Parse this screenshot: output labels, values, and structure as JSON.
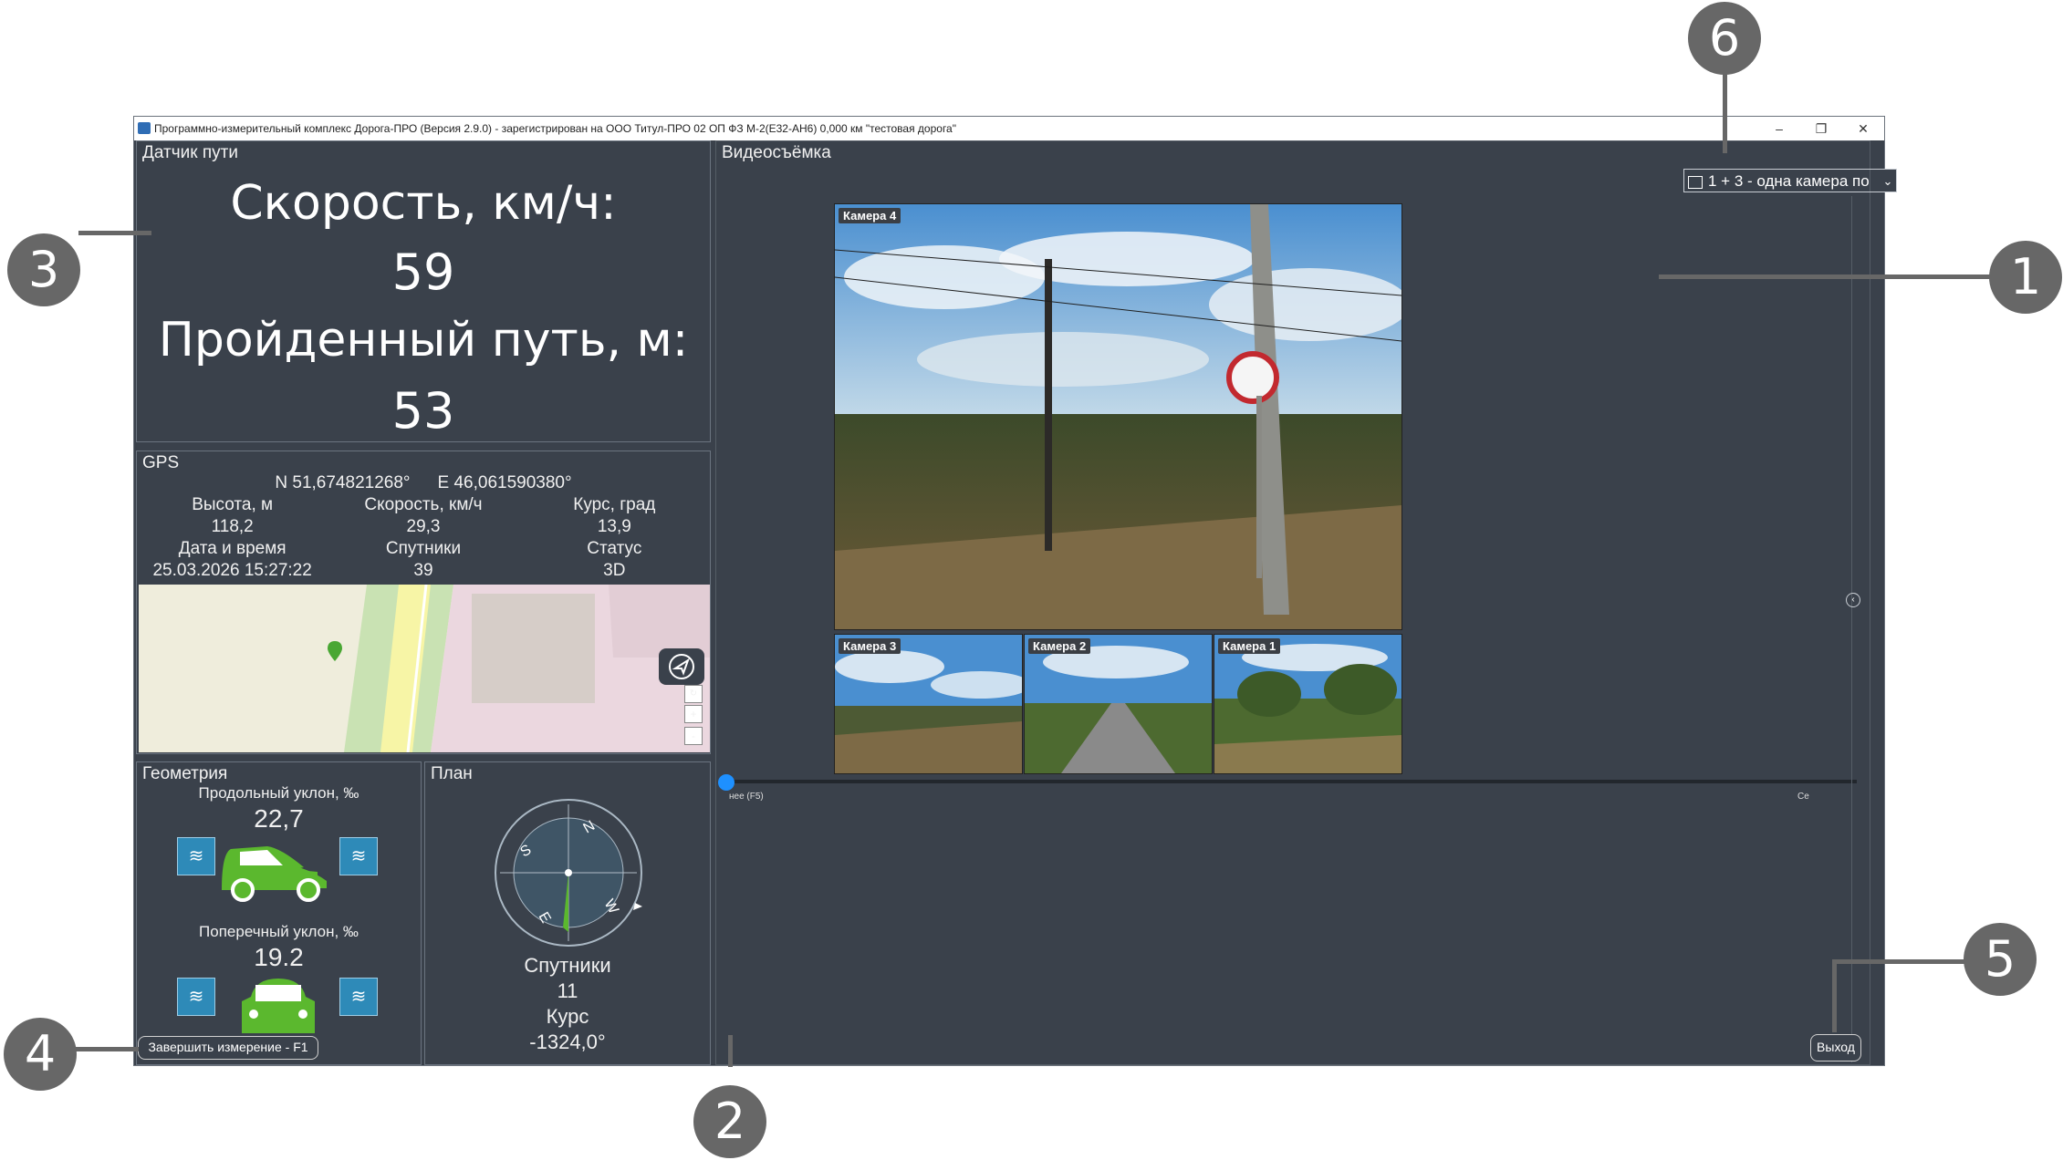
{
  "window": {
    "title": "Программно-измерительный комплекс Дорога-ПРО (Версия 2.9.0) - зарегистрирован на ООО Титул-ПРО 02 ОП ФЗ М-2(Е32-АН6) 0,000 км \"тестовая дорога\"",
    "minimize": "–",
    "maximize": "❐",
    "close": "✕"
  },
  "odometer": {
    "title": "Датчик пути",
    "speed_label": "Скорость, км/ч:",
    "speed_value": "59",
    "distance_label": "Пройденный путь, м:",
    "distance_value": "53"
  },
  "gps": {
    "title": "GPS",
    "lat": "N 51,674821268°",
    "lon": "E 46,061590380°",
    "row1_labels": [
      "Высота, м",
      "Скорость, км/ч",
      "Курс, град"
    ],
    "row1_values": [
      "118,2",
      "29,3",
      "13,9"
    ],
    "row2_labels": [
      "Дата и время",
      "Спутники",
      "Статус"
    ],
    "row2_values": [
      "25.03.2026 15:27:22",
      "39",
      "3D"
    ],
    "map_zoom_in": "+",
    "map_zoom_out": "-"
  },
  "geometry": {
    "title": "Геометрия",
    "long_slope_label": "Продольный уклон, ‰",
    "long_slope_value": "22,7",
    "cross_slope_label": "Поперечный уклон, ‰",
    "cross_slope_value": "19.2"
  },
  "plan": {
    "title": "План",
    "compass_letters": [
      "N",
      "E",
      "S",
      "W"
    ],
    "satellites_label": "Спутники",
    "satellites_value": "11",
    "course_label": "Курс",
    "course_value": "-1324,0°"
  },
  "video": {
    "title": "Видеосъёмка",
    "layout_select": "1 + 3 - одна камера по",
    "cameras": [
      "Камера 4",
      "Камера 3",
      "Камера 2",
      "Камера 1"
    ],
    "timeline_left": "нее (F5)",
    "timeline_right": "Се",
    "timeline_progress": 0
  },
  "buttons": {
    "finish": "Завершить измерение - F1",
    "exit": "Выход"
  },
  "callouts": [
    "1",
    "2",
    "3",
    "4",
    "5",
    "6"
  ],
  "colors": {
    "panel_bg": "#3a414b",
    "accent_green": "#5bb82e",
    "sensor_blue": "#2e8ab8",
    "callout_gray": "#676767",
    "timeline_blue": "#1e90ff"
  }
}
